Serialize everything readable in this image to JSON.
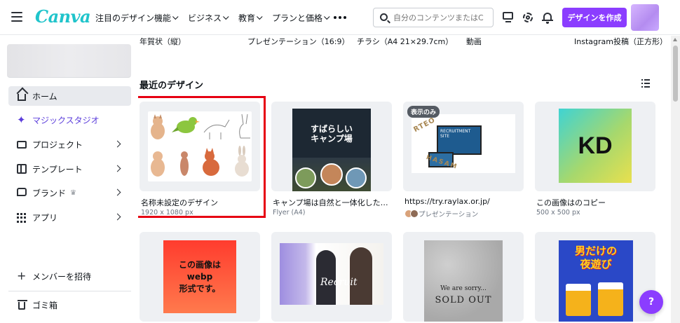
{
  "header": {
    "logo": "Canva",
    "nav": [
      "注目のデザイン機能",
      "ビジネス",
      "教育",
      "プランと価格"
    ],
    "search_placeholder": "自分のコンテンツまたはC",
    "create_button": "デザインを作成"
  },
  "sidebar": {
    "items": [
      {
        "label": "ホーム",
        "icon": "home-icon",
        "active": true
      },
      {
        "label": "マジックスタジオ",
        "icon": "sparkle-icon"
      },
      {
        "label": "プロジェクト",
        "icon": "folder-icon"
      },
      {
        "label": "テンプレート",
        "icon": "template-icon"
      },
      {
        "label": "ブランド",
        "icon": "brand-icon"
      },
      {
        "label": "アプリ",
        "icon": "apps-icon"
      }
    ],
    "invite": "メンバーを招待",
    "trash": "ゴミ箱"
  },
  "templates_row": [
    "年賀状（縦）",
    "プレゼンテーション（16:9）",
    "チラシ（A4 21×29.7cm）",
    "動画",
    "Instagram投稿（正方形）"
  ],
  "section_title": "最近のデザイン",
  "designs": [
    {
      "title": "名称未設定のデザイン",
      "sub": "1920 x 1080 px",
      "selected": true
    },
    {
      "title": "キャンプ場は自然と一体化した、素…",
      "sub": "Flyer (A4)",
      "thumb_text": "すばらしい\nキャンプ場"
    },
    {
      "title": "https://try.raylax.or.jp/",
      "sub": "プレゼンテーション",
      "badge": "表示のみ",
      "thumb_text_1": "RECRUITMENT SITE",
      "thumb_text_2": "RTEO",
      "thumb_text_3": "HASAM"
    },
    {
      "title": "この画像はのコピー",
      "sub": "500 x 500 px",
      "thumb_text": "KD"
    },
    {
      "thumb_text": "この画像はwebp\n形式です。"
    },
    {
      "thumb_text": "Recruit"
    },
    {
      "thumb_text_1": "We are sorry...",
      "thumb_text_2": "SOLD OUT"
    },
    {
      "thumb_text": "男だけの\n夜遊び"
    }
  ],
  "help_button": "?"
}
